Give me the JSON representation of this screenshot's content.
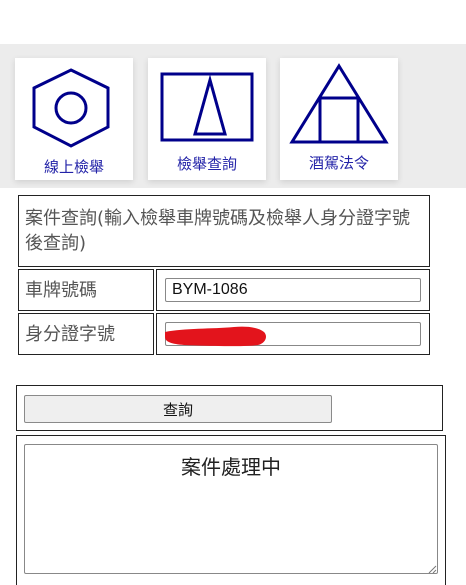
{
  "nav": {
    "cards": [
      {
        "label": "線上檢舉",
        "icon": "hexagon-nut-icon"
      },
      {
        "label": "檢舉查詢",
        "icon": "triangle-in-square-icon"
      },
      {
        "label": "酒駕法令",
        "icon": "square-in-triangle-icon"
      }
    ]
  },
  "form": {
    "heading": "案件查詢(輸入檢舉車牌號碼及檢舉人身分證字號後查詢)",
    "plate_label": "車牌號碼",
    "plate_value": "BYM-1086",
    "id_label": "身分證字號",
    "id_value": "",
    "query_button": "查詢",
    "result_text": "案件處理中"
  },
  "colors": {
    "icon_blue": "#00008b",
    "label_blue": "#2323a8",
    "redaction": "#e3141c"
  }
}
